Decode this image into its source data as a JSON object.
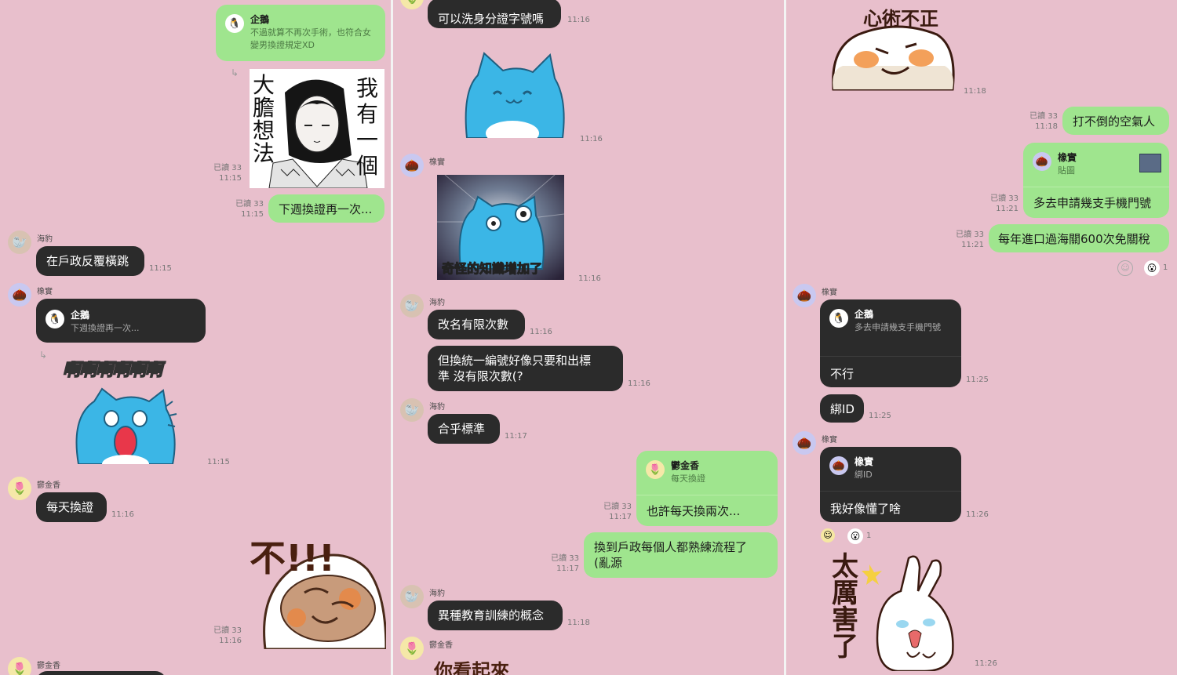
{
  "panel1": {
    "msg1": {
      "name": "企鵝",
      "text": "不過就算不再次手術，也符合女變男換證規定XD"
    },
    "sticker1": {
      "left": "大膽想法",
      "right": "我有一個",
      "read": "已讀 33",
      "time": "11:15"
    },
    "msg2": {
      "text": "下週換證再一次...",
      "read": "已讀 33",
      "time": "11:15"
    },
    "msg3": {
      "sender": "海豹",
      "text": "在戶政反覆橫跳",
      "time": "11:15"
    },
    "msg4": {
      "sender": "橡實",
      "name": "企鵝",
      "quote": "下週換證再一次...",
      "sticker_text": "啊啊啊啊啊啊",
      "time": "11:15"
    },
    "msg5": {
      "sender": "鬱金香",
      "text": "每天換證",
      "time": "11:16"
    },
    "sticker2": {
      "text": "不!!!",
      "read": "已讀 33",
      "time": "11:16"
    },
    "msg6": {
      "sender": "鬱金香"
    }
  },
  "panel2": {
    "msg1": {
      "text": "可以洗身分證字號嗎",
      "time": "11:16"
    },
    "sticker1": {
      "time": "11:16"
    },
    "msg2": {
      "sender": "橡實",
      "sticker_text": "奇怪的知識增加了",
      "time": "11:16"
    },
    "msg3": {
      "sender": "海豹",
      "text": "改名有限次數",
      "time": "11:16"
    },
    "msg4": {
      "text1": "但換統一編號好像只要和出標",
      "text2": "準 沒有限次數(?",
      "time": "11:16"
    },
    "msg5": {
      "sender": "海豹",
      "text": "合乎標準",
      "time": "11:17"
    },
    "msg6": {
      "name": "鬱金香",
      "quote": "每天換證",
      "text": "也許每天換兩次...",
      "read": "已讀 33",
      "time": "11:17"
    },
    "msg7": {
      "text1": "換到戶政每個人都熟練流程了",
      "text2": "(亂源",
      "read": "已讀 33",
      "time": "11:17"
    },
    "msg8": {
      "sender": "海豹",
      "text": "異種教育訓練的概念",
      "time": "11:18"
    },
    "msg9": {
      "sender": "鬱金香",
      "sticker_text": "你看起來"
    }
  },
  "panel3": {
    "sticker1": {
      "text": "心術不正",
      "time": "11:18"
    },
    "msg1": {
      "text": "打不倒的空氣人",
      "read": "已讀 33",
      "time": "11:18"
    },
    "msg2": {
      "name": "橡實",
      "quote": "貼圖",
      "text": "多去申請幾支手機門號",
      "read": "已讀 33",
      "time": "11:21"
    },
    "msg3": {
      "text": "每年進口過海關600次免關稅",
      "read": "已讀 33",
      "time": "11:21"
    },
    "msg4": {
      "sender": "橡實",
      "name": "企鵝",
      "quote": "多去申請幾支手機門號",
      "text": "不行",
      "time": "11:25"
    },
    "msg5": {
      "text": "綁ID",
      "time": "11:25"
    },
    "msg6": {
      "sender": "橡實",
      "name": "橡實",
      "quote": "綁ID",
      "text": "我好像懂了啥",
      "time": "11:26"
    },
    "sticker2": {
      "text": "太厲害了",
      "time": "11:26"
    },
    "reaction_count": "1"
  }
}
